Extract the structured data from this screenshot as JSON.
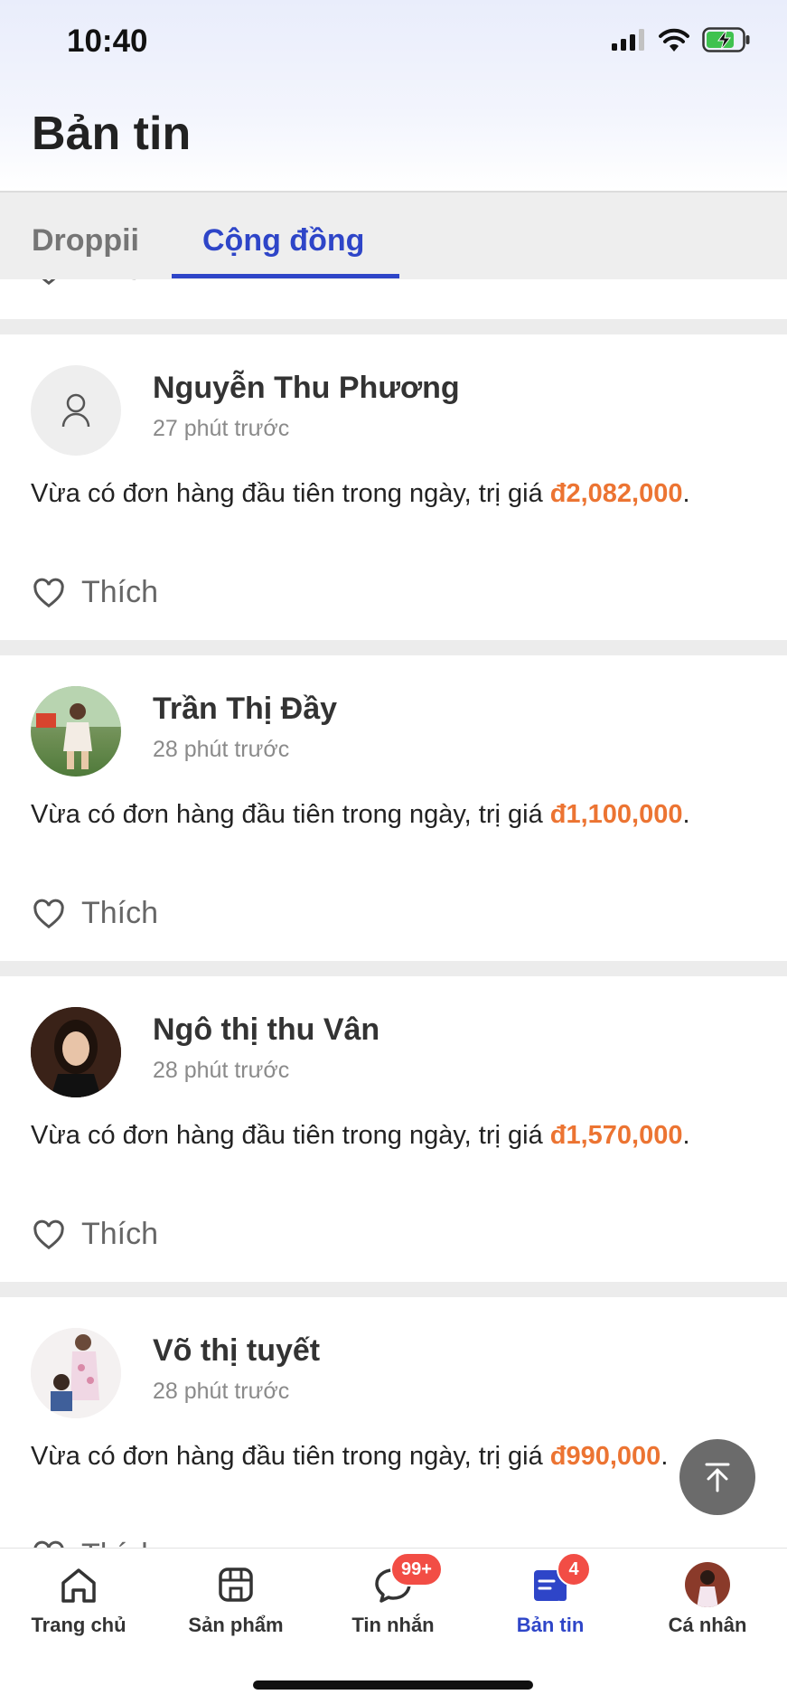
{
  "status_bar": {
    "time": "10:40"
  },
  "header": {
    "title": "Bản tin"
  },
  "tabs": [
    {
      "label": "Droppii",
      "active": false
    },
    {
      "label": "Cộng đồng",
      "active": true
    }
  ],
  "partial_like_label": "Thích",
  "posts": [
    {
      "author": "Nguyễn Thu Phương",
      "time": "27 phút trước",
      "message": "Vừa có đơn hàng đầu tiên trong ngày, trị giá ",
      "amount": "đ2,082,000",
      "suffix": ".",
      "like_label": "Thích",
      "avatar": "default-avatar"
    },
    {
      "author": "Trần Thị Đầy",
      "time": "28 phút trước",
      "message": "Vừa có đơn hàng đầu tiên trong ngày, trị giá ",
      "amount": "đ1,100,000",
      "suffix": ".",
      "like_label": "Thích",
      "avatar": "photo-avatar"
    },
    {
      "author": "Ngô thị thu Vân",
      "time": "28 phút trước",
      "message": "Vừa có đơn hàng đầu tiên trong ngày, trị giá ",
      "amount": "đ1,570,000",
      "suffix": ".",
      "like_label": "Thích",
      "avatar": "photo-avatar"
    },
    {
      "author": "Võ thị tuyết",
      "time": "28 phút trước",
      "message": "Vừa có đơn hàng đầu tiên trong ngày, trị giá ",
      "amount": "đ990,000",
      "suffix": ".",
      "like_label": "Thích",
      "avatar": "photo-avatar"
    }
  ],
  "bottom_nav": [
    {
      "label": "Trang chủ",
      "icon": "home-icon"
    },
    {
      "label": "Sản phẩm",
      "icon": "store-icon"
    },
    {
      "label": "Tin nhắn",
      "icon": "chat-icon",
      "badge": "99+"
    },
    {
      "label": "Bản tin",
      "icon": "news-icon",
      "badge": "4",
      "active": true
    },
    {
      "label": "Cá nhân",
      "icon": "avatar"
    }
  ],
  "colors": {
    "accent": "#2e45c8",
    "amount": "#ec7432",
    "badge": "#f24d45"
  }
}
